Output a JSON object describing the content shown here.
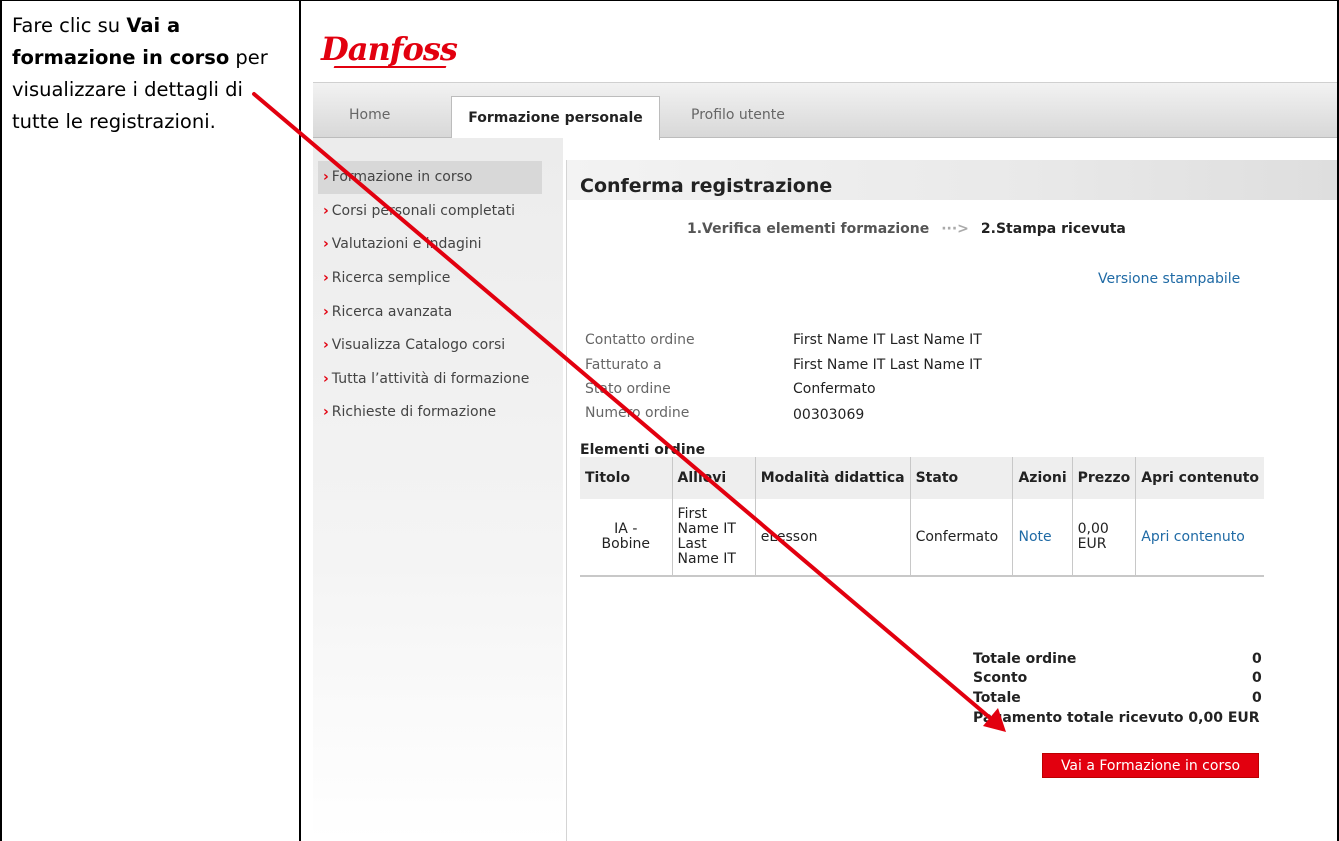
{
  "instruction": {
    "prefix": "Fare clic su ",
    "bold": "Vai a formazione in corso",
    "suffix": " per visualizzare i dettagli di tutte le registrazioni."
  },
  "brand": {
    "logo_text": "Danfoss",
    "accent_color": "#e2000f",
    "link_color": "#1f6aa5"
  },
  "tabs": {
    "home": "Home",
    "active": "Formazione personale",
    "profile": "Profilo utente"
  },
  "sidebar": {
    "items": [
      "Formazione in corso",
      "Corsi personali completati",
      "Valutazioni e indagini",
      "Ricerca semplice",
      "Ricerca avanzata",
      "Visualizza Catalogo corsi",
      "Tutta l’attività di formazione",
      "Richieste di formazione"
    ],
    "chevron_icon": "chevron-right-icon"
  },
  "main": {
    "title": "Conferma registrazione",
    "step1": "1.Verifica elementi formazione",
    "step_separator": "···>",
    "step2": "2.Stampa ricevuta",
    "print_link": "Versione stampabile",
    "info": {
      "labels": [
        "Contatto ordine",
        "Fatturato a",
        "Stato ordine",
        "Numero ordine"
      ],
      "values": [
        "First Name IT Last Name IT",
        "First Name IT Last Name IT",
        "Confermato",
        "00303069"
      ]
    },
    "items_title": "Elementi ordine",
    "table": {
      "headers": [
        "Titolo",
        "Allievi",
        "Modalità didattica",
        "Stato",
        "Azioni",
        "Prezzo",
        "Apri contenuto"
      ],
      "row": {
        "titolo_1": "IA -",
        "titolo_2": "Bobine",
        "allievi_1": "First",
        "allievi_2": "Name IT",
        "allievi_3": "Last",
        "allievi_4": "Name IT",
        "modalita": "eLesson",
        "stato": "Confermato",
        "azioni": "Note",
        "prezzo_1": "0,00",
        "prezzo_2": "EUR",
        "apri": "Apri contenuto"
      }
    },
    "totals": {
      "labels": [
        "Totale ordine",
        "Sconto",
        "Totale"
      ],
      "values": [
        "0",
        "0",
        "0"
      ],
      "payment": "Pagamento totale ricevuto 0,00 EUR"
    },
    "go_button": "Vai a Formazione in corso"
  }
}
